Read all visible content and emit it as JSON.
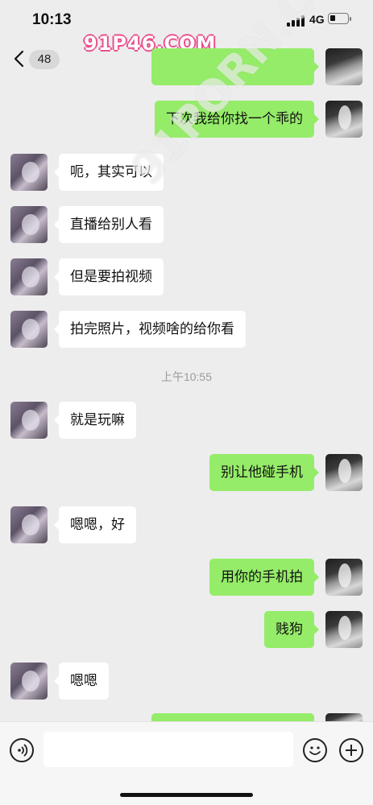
{
  "status": {
    "time": "10:13",
    "network": "4G"
  },
  "nav": {
    "unread_count": "48"
  },
  "watermark": {
    "site": "91P46.COM",
    "diagonal": "91PORN.COM"
  },
  "messages": [
    {
      "side": "right",
      "text": "下次我给你找一个乖的"
    },
    {
      "side": "left",
      "text": "呃，其实可以"
    },
    {
      "side": "left",
      "text": "直播给别人看"
    },
    {
      "side": "left",
      "text": "但是要拍视频"
    },
    {
      "side": "left",
      "text": "拍完照片，视频啥的给你看"
    },
    {
      "side": "left",
      "text": "就是玩嘛"
    },
    {
      "side": "right",
      "text": "别让他碰手机"
    },
    {
      "side": "left",
      "text": "嗯嗯，好"
    },
    {
      "side": "right",
      "text": "用你的手机拍"
    },
    {
      "side": "right",
      "text": "贱狗"
    },
    {
      "side": "left",
      "text": "嗯嗯"
    }
  ],
  "timestamp": "上午10:55",
  "input": {
    "placeholder": ""
  },
  "colors": {
    "my_bubble": "#95ec69",
    "their_bubble": "#ffffff",
    "background": "#ededed"
  }
}
